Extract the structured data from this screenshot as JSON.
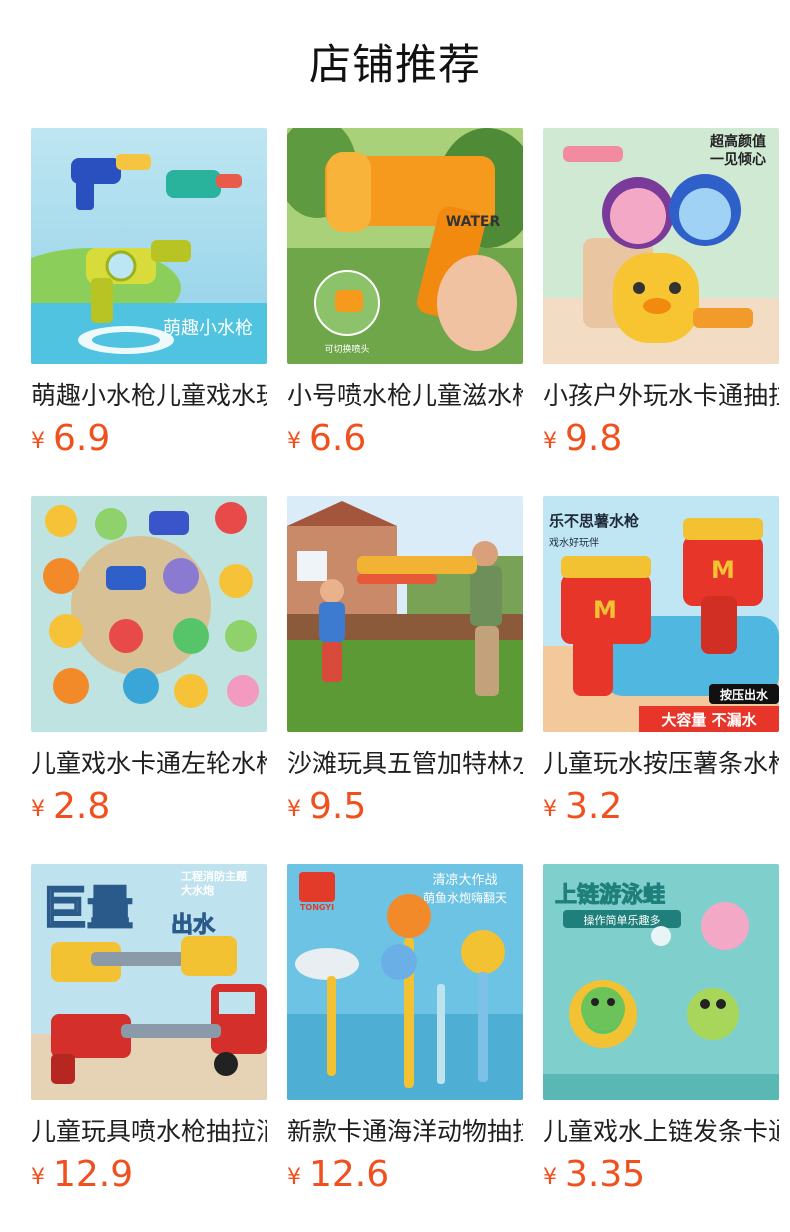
{
  "title": "店铺推荐",
  "currency": "¥",
  "products": [
    {
      "name": "萌趣小水枪儿童戏水玩具",
      "price": "6.9",
      "image_text": [
        "萌趣小水枪"
      ],
      "image_icon": "water-gun-set-image"
    },
    {
      "name": "小号喷水枪儿童滋水枪玩具",
      "price": "6.6",
      "image_text": [
        "WATER",
        "可切换喷头"
      ],
      "image_icon": "orange-water-gun-image"
    },
    {
      "name": "小孩户外玩水卡通抽拉背包水枪",
      "price": "9.8",
      "image_text": [
        "超高颜值",
        "一见倾心"
      ],
      "image_icon": "backpack-water-gun-image"
    },
    {
      "name": "儿童戏水卡通左轮水枪",
      "price": "2.8",
      "image_text": [],
      "image_icon": "cartoon-water-guns-image"
    },
    {
      "name": "沙滩玩具五管加特林水枪",
      "price": "9.5",
      "image_text": [],
      "image_icon": "family-water-fight-image"
    },
    {
      "name": "儿童玩水按压薯条水枪",
      "price": "3.2",
      "image_text": [
        "乐不思薯水枪",
        "戏水好玩伴",
        "按压出水",
        "大容量 不漏水"
      ],
      "image_icon": "fries-water-gun-image"
    },
    {
      "name": "儿童玩具喷水枪抽拉消防车",
      "price": "12.9",
      "image_text": [
        "巨量",
        "出水",
        "工程消防主题",
        "大水炮"
      ],
      "image_icon": "fire-truck-water-gun-image"
    },
    {
      "name": "新款卡通海洋动物抽拉水枪",
      "price": "12.6",
      "image_text": [
        "TONGYI",
        "清凉大作战",
        "萌鱼水炮嗨翻天"
      ],
      "image_icon": "ocean-animal-water-gun-image"
    },
    {
      "name": "儿童戏水上链发条卡通青蛙",
      "price": "3.35",
      "image_text": [
        "上链游泳蛙",
        "操作简单乐趣多"
      ],
      "image_icon": "wind-up-frog-image"
    }
  ],
  "colors": {
    "price": "#f0501e",
    "title": "#111111"
  }
}
